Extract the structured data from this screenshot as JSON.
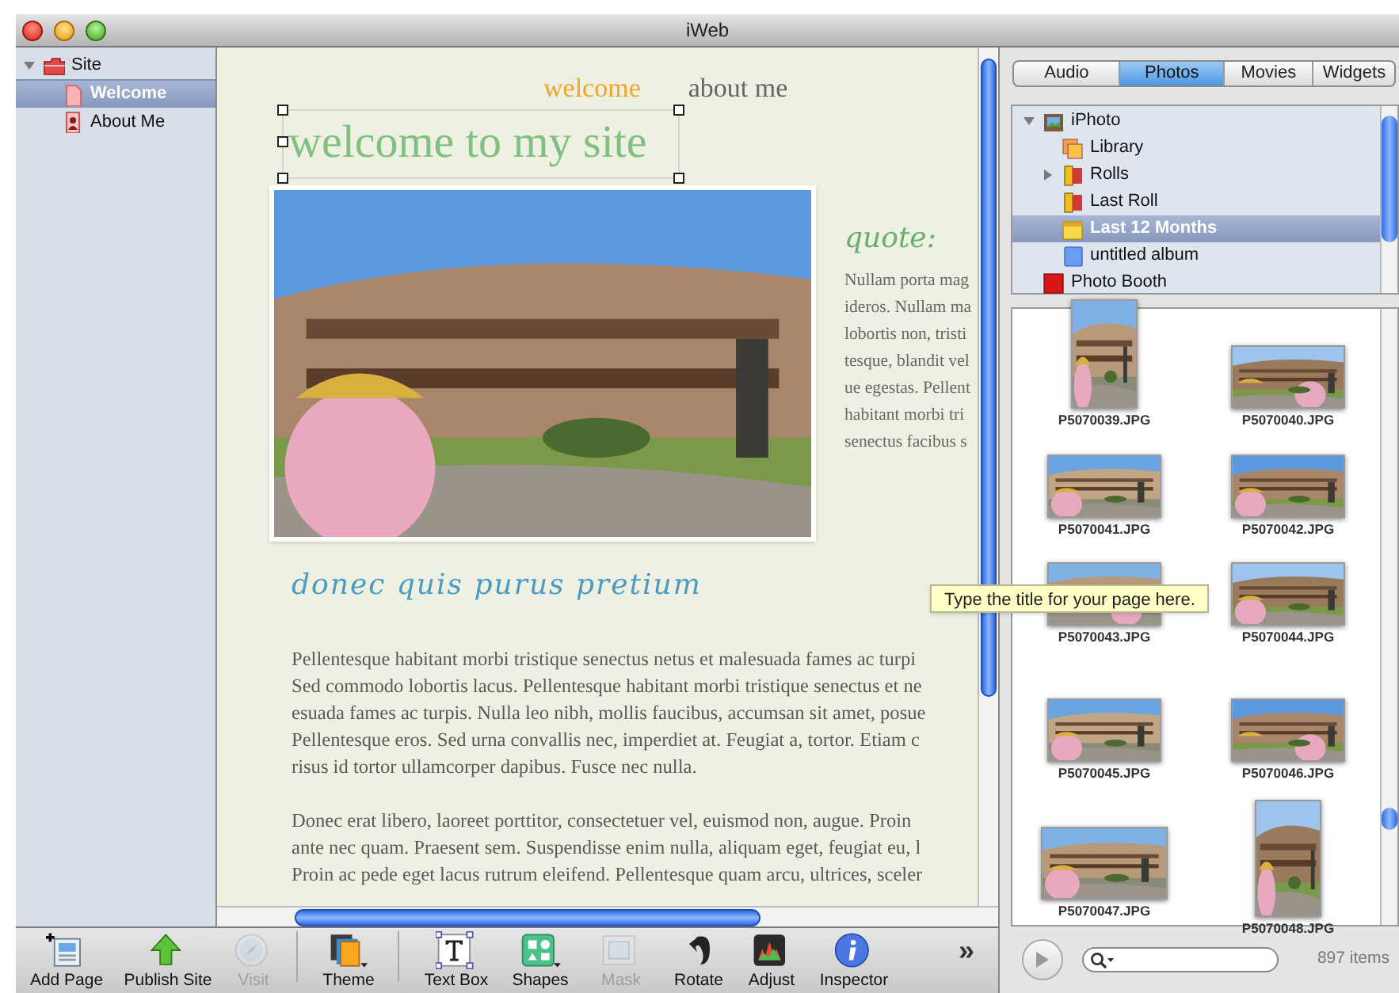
{
  "window": {
    "title": "iWeb"
  },
  "sidebar": {
    "items": [
      {
        "label": "Site",
        "kind": "site",
        "expanded": true,
        "selected": false,
        "children": [
          {
            "label": "Welcome",
            "kind": "page",
            "selected": true
          },
          {
            "label": "About Me",
            "kind": "profile",
            "selected": false
          }
        ]
      }
    ]
  },
  "page": {
    "nav": [
      {
        "label": "welcome",
        "selected": true
      },
      {
        "label": "about me",
        "selected": false
      }
    ],
    "title_box": {
      "text": "welcome to my site",
      "selected": true
    },
    "photo": {
      "kind": "picture"
    },
    "quote_heading": "quote:",
    "quote_lines": [
      "Nullam porta mag",
      "ideros. Nullam ma",
      "lobortis non, tristi",
      "tesque, blandit vel",
      "ue egestas. Pellent",
      "habitant morbi tri",
      "senectus facibus s"
    ],
    "subheading": "donec quis purus pretium",
    "paragraphs": [
      [
        "Pellentesque habitant morbi tristique senectus netus et malesuada fames ac turpi",
        "Sed commodo lobortis lacus. Pellentesque habitant morbi tristique senectus et ne",
        "esuada fames ac turpis. Nulla leo nibh, mollis faucibus, accumsan sit amet, posue",
        "Pellentesque eros. Sed urna convallis nec, imperdiet at. Feugiat a, tortor. Etiam c",
        "risus id tortor ullamcorper dapibus. Fusce nec nulla."
      ],
      [
        "Donec erat libero, laoreet porttitor, consectetuer vel, euismod non, augue. Proin",
        "ante nec quam. Praesent sem. Suspendisse enim nulla, aliquam eget, feugiat eu, l",
        "Proin ac pede eget lacus rutrum eleifend. Pellentesque quam arcu, ultrices, sceler"
      ]
    ]
  },
  "tooltip": "Type the title for your page here.",
  "toolbar": [
    {
      "label": "Add Page",
      "kind": "add-page",
      "disabled": false
    },
    {
      "label": "Publish Site",
      "kind": "publish",
      "disabled": false
    },
    {
      "label": "Visit",
      "kind": "visit",
      "disabled": true
    },
    {
      "label": "Theme",
      "kind": "theme",
      "disabled": false
    },
    {
      "label": "Text Box",
      "kind": "text-box",
      "disabled": false
    },
    {
      "label": "Shapes",
      "kind": "shapes",
      "disabled": false
    },
    {
      "label": "Mask",
      "kind": "mask",
      "disabled": true
    },
    {
      "label": "Rotate",
      "kind": "rotate",
      "disabled": false
    },
    {
      "label": "Adjust",
      "kind": "adjust",
      "disabled": false
    },
    {
      "label": "Inspector",
      "kind": "inspector",
      "disabled": false
    },
    {
      "label": "»",
      "kind": "more",
      "disabled": false
    }
  ],
  "media_browser": {
    "tabs": [
      {
        "label": "Audio",
        "selected": false
      },
      {
        "label": "Photos",
        "selected": true
      },
      {
        "label": "Movies",
        "selected": false
      },
      {
        "label": "Widgets",
        "selected": false
      }
    ],
    "tree": [
      {
        "label": "iPhoto",
        "kind": "iphoto",
        "expanded": true,
        "selected": false,
        "children": [
          {
            "label": "Library",
            "kind": "library",
            "selected": false
          },
          {
            "label": "Rolls",
            "kind": "roll",
            "expanded": false,
            "selected": false
          },
          {
            "label": "Last Roll",
            "kind": "roll",
            "selected": false
          },
          {
            "label": "Last 12 Months",
            "kind": "smart-album",
            "selected": true
          },
          {
            "label": "untitled album",
            "kind": "album",
            "selected": false
          }
        ]
      },
      {
        "label": "Photo Booth",
        "kind": "photo-booth",
        "selected": false
      }
    ],
    "photos": [
      {
        "name": "P5070039.JPG",
        "kind": "portrait"
      },
      {
        "name": "P5070040.JPG",
        "kind": "landscape"
      },
      {
        "name": "P5070041.JPG",
        "kind": "landscape"
      },
      {
        "name": "P5070042.JPG",
        "kind": "landscape"
      },
      {
        "name": "P5070043.JPG",
        "kind": "landscape"
      },
      {
        "name": "P5070044.JPG",
        "kind": "landscape"
      },
      {
        "name": "P5070045.JPG",
        "kind": "landscape"
      },
      {
        "name": "P5070046.JPG",
        "kind": "landscape"
      },
      {
        "name": "P5070047.JPG",
        "kind": "landscape"
      },
      {
        "name": "P5070048.JPG",
        "kind": "portrait"
      }
    ],
    "item_count": "897 items"
  }
}
